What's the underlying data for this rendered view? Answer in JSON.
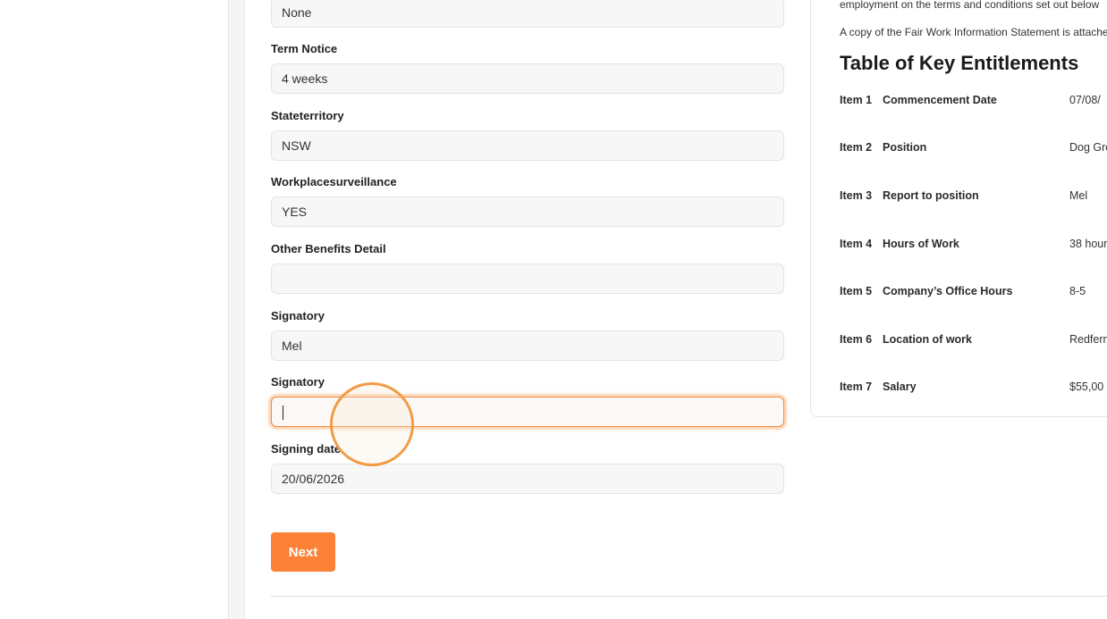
{
  "form": {
    "fields": [
      {
        "label": "",
        "value": "None"
      },
      {
        "label": "Term Notice",
        "value": "4 weeks"
      },
      {
        "label": "Stateterritory",
        "value": "NSW"
      },
      {
        "label": "Workplacesurveillance",
        "value": "YES"
      },
      {
        "label": "Other Benefits Detail",
        "value": ""
      },
      {
        "label": "Signatory",
        "value": "Mel"
      },
      {
        "label": "Signatory",
        "value": ""
      },
      {
        "label": "Signing date",
        "value": "20/06/2026"
      }
    ],
    "next_label": "Next"
  },
  "panel": {
    "intro_line1": "employment on the terms and conditions set out below",
    "intro_line2": "A copy of the Fair Work Information Statement is attached",
    "title": "Table of Key Entitlements",
    "rows": [
      {
        "item": "Item 1",
        "label": "Commencement Date",
        "value": "07/08/"
      },
      {
        "item": "Item 2",
        "label": "Position",
        "value": "Dog Gro"
      },
      {
        "item": "Item 3",
        "label": "Report to position",
        "value": "Mel"
      },
      {
        "item": "Item 4",
        "label": "Hours of Work",
        "value": "38 hour"
      },
      {
        "item": "Item 5",
        "label": "Company’s Office Hours",
        "value": "8-5"
      },
      {
        "item": "Item 6",
        "label": "Location of work",
        "value": "Redfern"
      },
      {
        "item": "Item 7",
        "label": "Salary",
        "value": "$55,00"
      }
    ]
  },
  "colors": {
    "accent": "#fb8236",
    "focus_ring": "#f28a3c"
  }
}
